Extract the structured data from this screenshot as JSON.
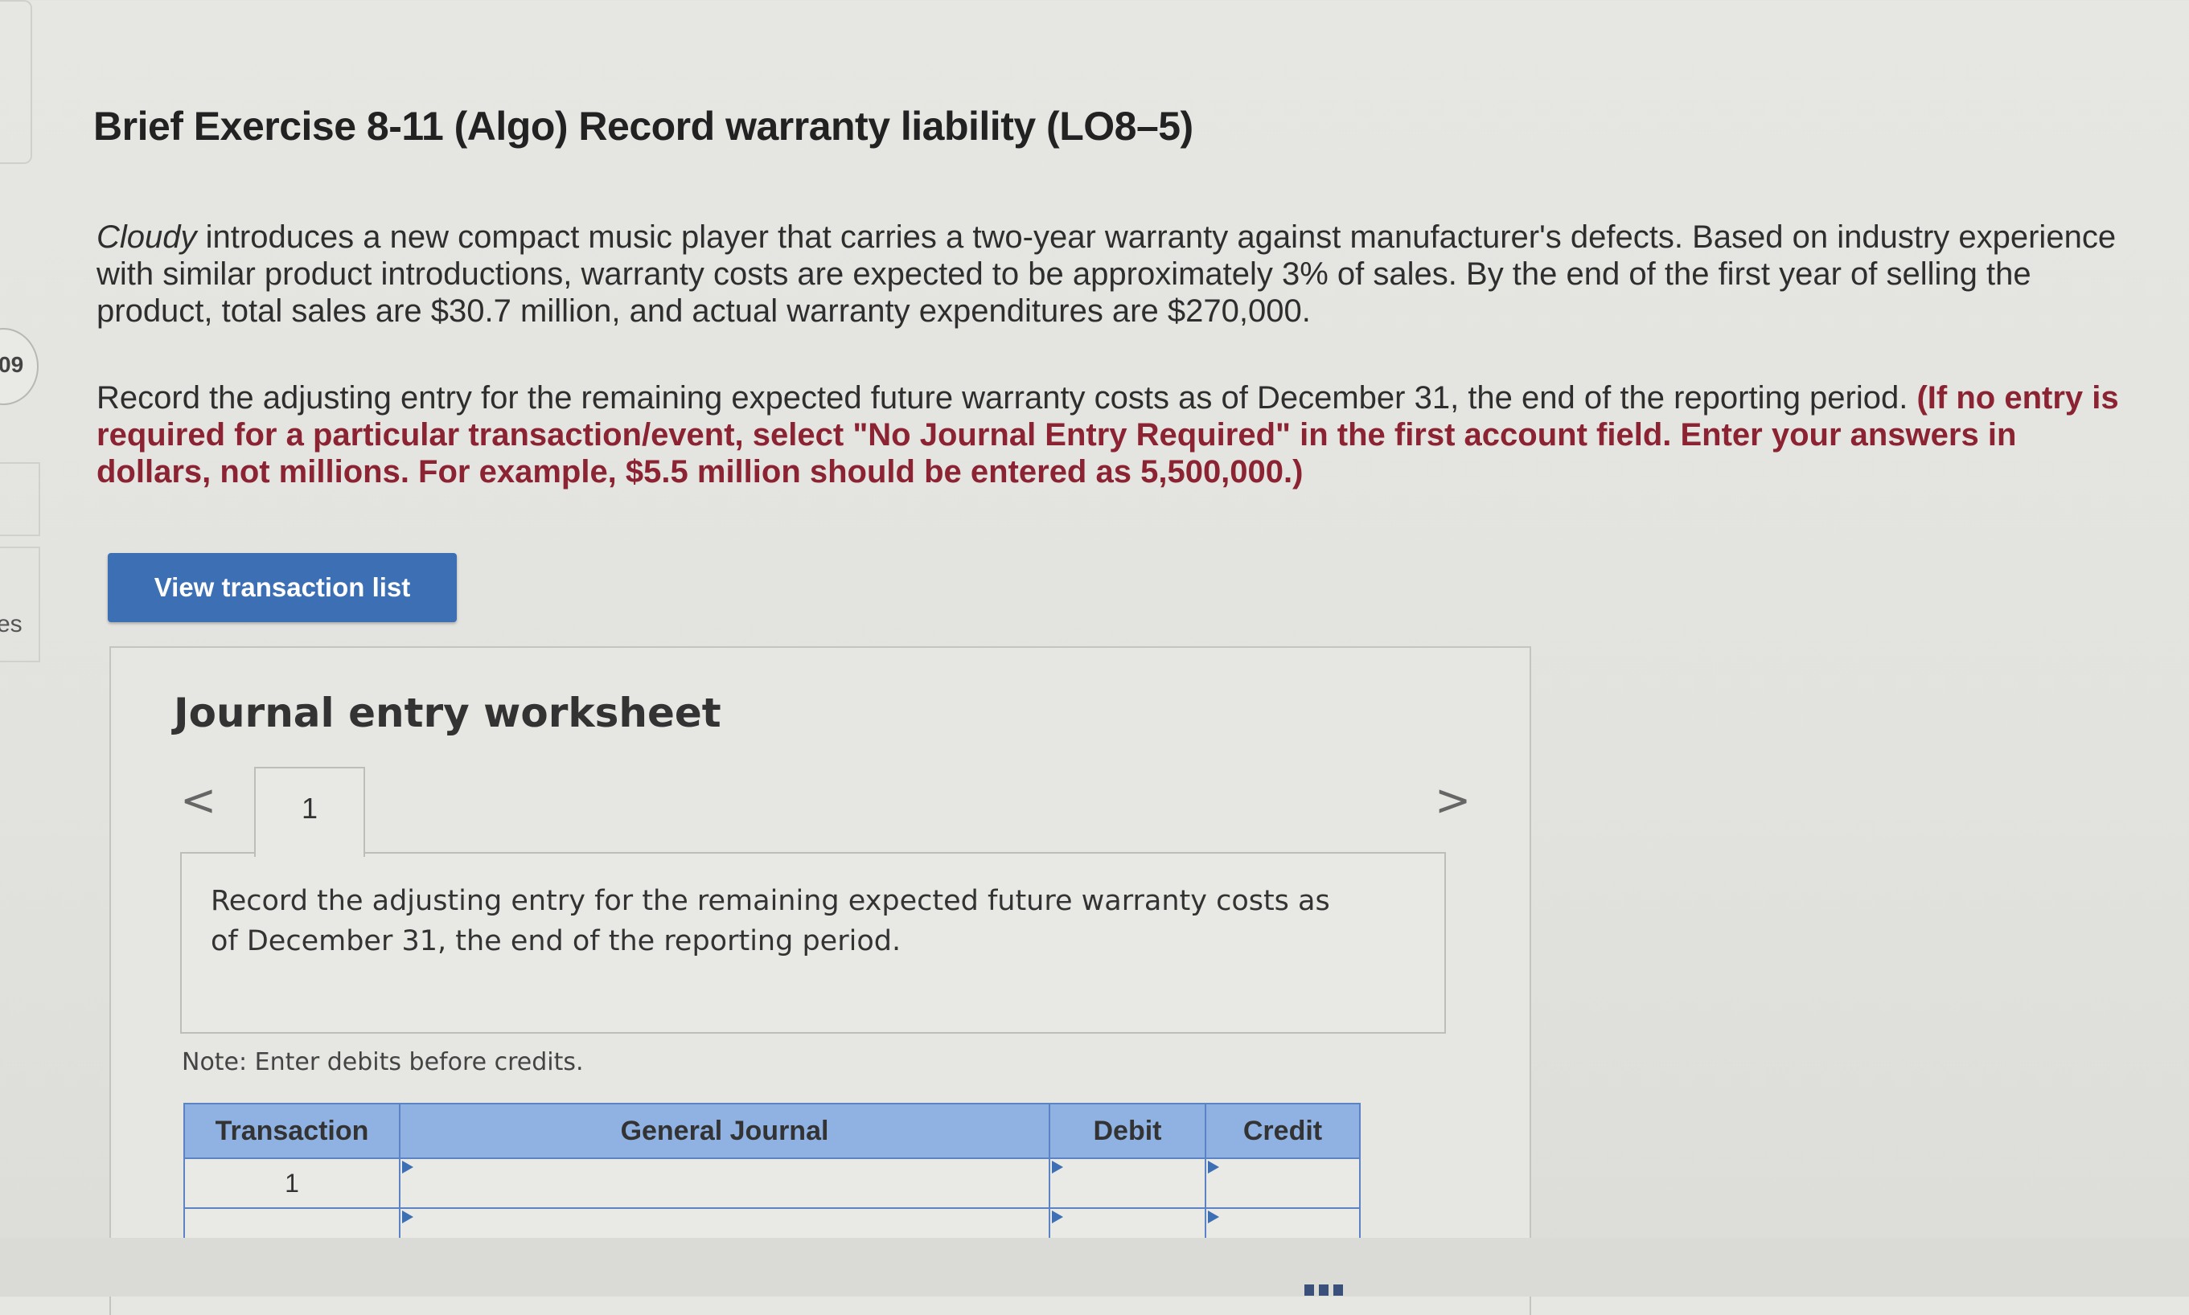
{
  "sidebar": {
    "badge_fragment": "09",
    "text_fragment": "es"
  },
  "exercise": {
    "title": "Brief Exercise 8-11 (Algo) Record warranty liability (LO8–5)",
    "company": "Cloudy",
    "paragraph1_rest": " introduces a new compact music player that carries a two-year warranty against manufacturer's defects. Based on industry experience with similar product introductions, warranty costs are expected to be approximately 3% of sales. By the end of the first year of selling the product, total sales are $30.7 million, and actual warranty expenditures are $270,000.",
    "paragraph2": "Record the adjusting entry for the remaining expected future warranty costs as of December 31, the end of the reporting period. ",
    "paragraph2_instruction": "(If no entry is required for a particular transaction/event, select \"No Journal Entry Required\" in the first account field. Enter your answers in dollars, not millions. For example, $5.5 million should be entered as 5,500,000.)"
  },
  "buttons": {
    "view_transaction_list": "View transaction list"
  },
  "worksheet": {
    "title": "Journal entry worksheet",
    "prev_arrow": "<",
    "next_arrow": ">",
    "tabs": [
      "1"
    ],
    "instruction": "Record the adjusting entry for the remaining expected future warranty costs as of December 31, the end of the reporting period.",
    "note": "Note: Enter debits before credits.",
    "table": {
      "headers": [
        "Transaction",
        "General Journal",
        "Debit",
        "Credit"
      ],
      "rows": [
        {
          "transaction": "1",
          "account": "",
          "debit": "",
          "credit": ""
        },
        {
          "transaction": "",
          "account": "",
          "debit": "",
          "credit": ""
        }
      ]
    }
  },
  "colors": {
    "accent_button": "#3c6fb4",
    "table_header": "#8fb2e3",
    "instruction_red": "#8b2332"
  }
}
